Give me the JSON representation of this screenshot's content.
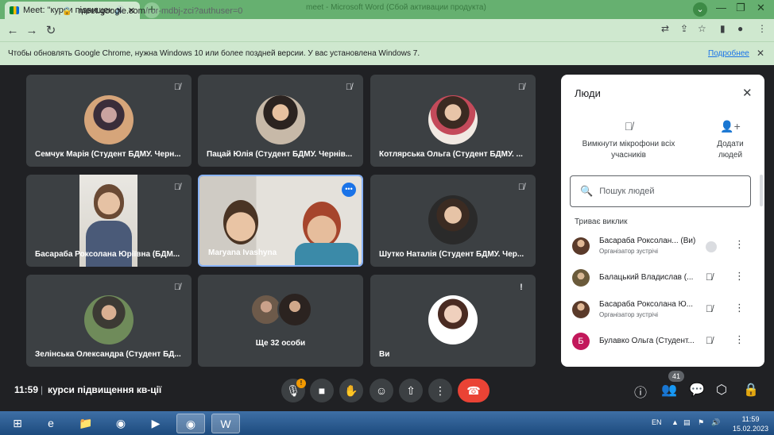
{
  "browser": {
    "tab_title": "Meet: \"курси підвищення кв",
    "new_tab": "+",
    "window_title": "meet - Microsoft Word (Сбой активации продукта)",
    "url_host": "meet.google.com",
    "url_path": "/ror-mdbj-zci?authuser=0",
    "info_message": "Чтобы обновлять Google Chrome, нужна Windows 10 или более поздней версии. У вас установлена Windows 7.",
    "info_link": "Подробнее"
  },
  "tiles": [
    {
      "name": "Семчук Марія (Студент БДМУ. Черн..."
    },
    {
      "name": "Пацай Юлія (Студент БДМУ. Чернів..."
    },
    {
      "name": "Котлярська Ольга (Студент БДМУ. ..."
    },
    {
      "name": "Басараба Роксолана Юріївна (БДМ..."
    },
    {
      "name": "Maryana Ivashyna"
    },
    {
      "name": "Шутко Наталія (Студент БДМУ. Чер..."
    },
    {
      "name": "Зелінська Олександра (Студент БД..."
    },
    {
      "name": "Ще 32 особи"
    },
    {
      "name": "Ви"
    }
  ],
  "people_panel": {
    "title": "Люди",
    "mute_all": "Вимкнути мікрофони всіх учасників",
    "add_people": "Додати людей",
    "search_placeholder": "Пошук людей",
    "section_title": "Триває виклик",
    "participants": [
      {
        "name": "Басараба Роксолан...",
        "suffix": "(Ви)",
        "role": "Організатор зустрічі"
      },
      {
        "name": "Балацький Владислав (...",
        "role": ""
      },
      {
        "name": "Басараба Роксолана Ю...",
        "role": "Організатор зустрічі"
      },
      {
        "name": "Булавко Ольга (Студент...",
        "role": "",
        "initial": "Б"
      }
    ]
  },
  "controls": {
    "time": "11:59",
    "separator": "|",
    "meeting_name": "курси підвищення кв-ції",
    "mic_badge": "!",
    "participant_count": "41"
  },
  "taskbar": {
    "lang": "EN",
    "time": "11:59",
    "date": "15.02.2023"
  }
}
